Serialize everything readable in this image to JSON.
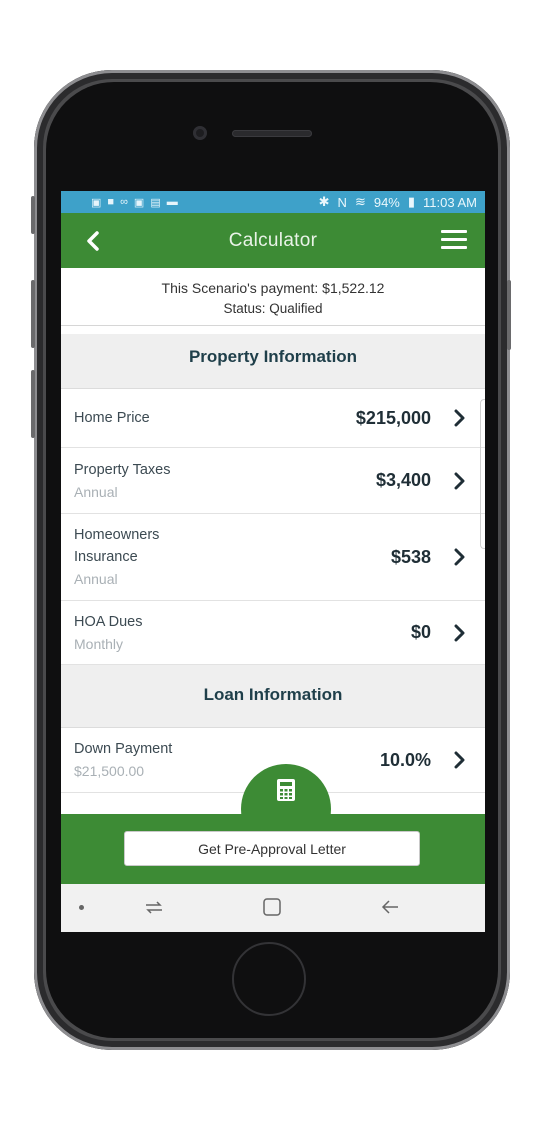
{
  "status_bar": {
    "battery": "94%",
    "time": "11:03 AM"
  },
  "navbar": {
    "title": "Calculator"
  },
  "summary": {
    "payment_text": "This Scenario's payment: $1,522.12",
    "status_text": "Status: Qualified"
  },
  "property_section": {
    "title": "Property Information",
    "rows": [
      {
        "label": "Home Price",
        "sub": "",
        "value": "$215,000"
      },
      {
        "label": "Property Taxes",
        "sub": "Annual",
        "value": "$3,400"
      },
      {
        "label": "Homeowners Insurance",
        "sub": "Annual",
        "value": "$538"
      },
      {
        "label": "HOA Dues",
        "sub": "Monthly",
        "value": "$0"
      }
    ]
  },
  "loan_section": {
    "title": "Loan Information",
    "rows": [
      {
        "label": "Down Payment",
        "sub": "$21,500.00",
        "value": "10.0%"
      }
    ]
  },
  "actions": {
    "preapproval_label": "Get Pre-Approval Letter"
  },
  "colors": {
    "brand_green": "#3d8b35",
    "status_bar_blue": "#3ea1c9",
    "heading_text": "#1f3f4a"
  }
}
